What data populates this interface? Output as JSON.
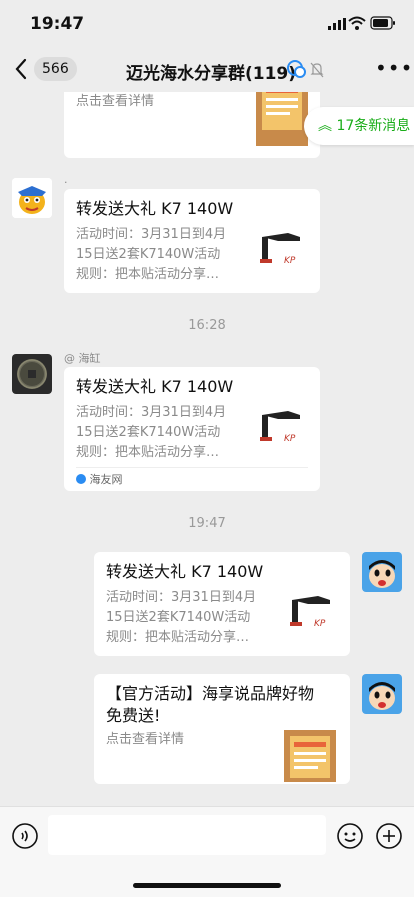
{
  "status": {
    "time": "19:47"
  },
  "nav": {
    "unread": "566",
    "title": "迈光海水分享群(119)"
  },
  "new_msgs": "17条新消息",
  "partial_card": {
    "desc": "点击查看详情"
  },
  "msg1": {
    "sender": "·",
    "title": "转发送大礼 K7 140W",
    "desc": [
      "活动时间：3月31日到4月",
      "15日送2套K7140W活动",
      "规则：把本贴活动分享…"
    ]
  },
  "timestamp1": "16:28",
  "msg2": {
    "sender": "@ 海缸",
    "title": "转发送大礼 K7 140W",
    "desc": [
      "活动时间：3月31日到4月",
      "15日送2套K7140W活动",
      "规则：把本贴活动分享…"
    ],
    "source": "海友网"
  },
  "timestamp2": "19:47",
  "msg3": {
    "title": "转发送大礼 K7 140W",
    "desc": [
      "活动时间：3月31日到4月",
      "15日送2套K7140W活动",
      "规则：把本贴活动分享…"
    ]
  },
  "msg4": {
    "title": [
      "【官方活动】海享说品牌好物",
      "免费送!"
    ],
    "desc": "点击查看详情"
  },
  "thumb_logo": "KP",
  "colors": {
    "accent": "#1aad19",
    "bg": "#ededed"
  }
}
